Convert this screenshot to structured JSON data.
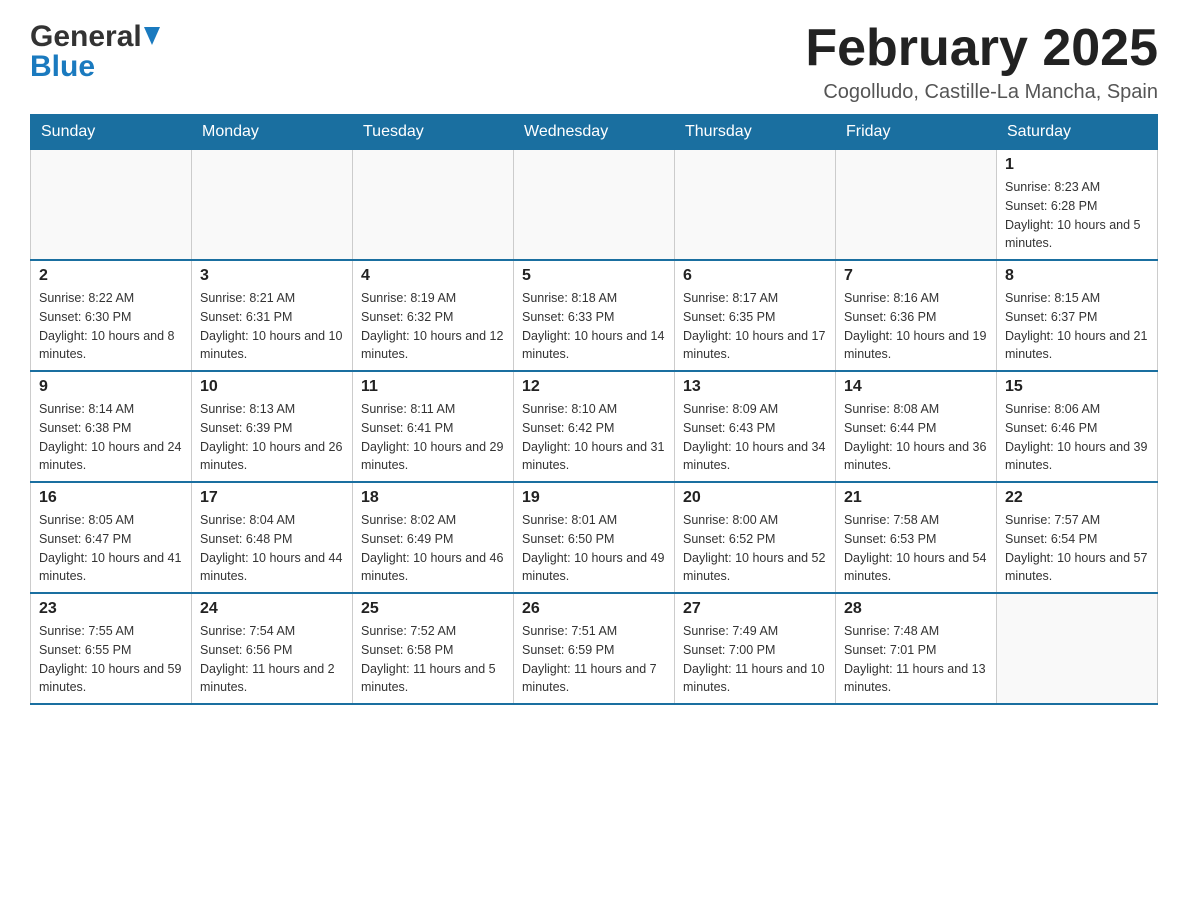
{
  "header": {
    "logo_general": "General",
    "logo_blue": "Blue",
    "month_title": "February 2025",
    "location": "Cogolludo, Castille-La Mancha, Spain"
  },
  "days_of_week": [
    "Sunday",
    "Monday",
    "Tuesday",
    "Wednesday",
    "Thursday",
    "Friday",
    "Saturday"
  ],
  "weeks": [
    [
      {
        "day": "",
        "info": ""
      },
      {
        "day": "",
        "info": ""
      },
      {
        "day": "",
        "info": ""
      },
      {
        "day": "",
        "info": ""
      },
      {
        "day": "",
        "info": ""
      },
      {
        "day": "",
        "info": ""
      },
      {
        "day": "1",
        "info": "Sunrise: 8:23 AM\nSunset: 6:28 PM\nDaylight: 10 hours and 5 minutes."
      }
    ],
    [
      {
        "day": "2",
        "info": "Sunrise: 8:22 AM\nSunset: 6:30 PM\nDaylight: 10 hours and 8 minutes."
      },
      {
        "day": "3",
        "info": "Sunrise: 8:21 AM\nSunset: 6:31 PM\nDaylight: 10 hours and 10 minutes."
      },
      {
        "day": "4",
        "info": "Sunrise: 8:19 AM\nSunset: 6:32 PM\nDaylight: 10 hours and 12 minutes."
      },
      {
        "day": "5",
        "info": "Sunrise: 8:18 AM\nSunset: 6:33 PM\nDaylight: 10 hours and 14 minutes."
      },
      {
        "day": "6",
        "info": "Sunrise: 8:17 AM\nSunset: 6:35 PM\nDaylight: 10 hours and 17 minutes."
      },
      {
        "day": "7",
        "info": "Sunrise: 8:16 AM\nSunset: 6:36 PM\nDaylight: 10 hours and 19 minutes."
      },
      {
        "day": "8",
        "info": "Sunrise: 8:15 AM\nSunset: 6:37 PM\nDaylight: 10 hours and 21 minutes."
      }
    ],
    [
      {
        "day": "9",
        "info": "Sunrise: 8:14 AM\nSunset: 6:38 PM\nDaylight: 10 hours and 24 minutes."
      },
      {
        "day": "10",
        "info": "Sunrise: 8:13 AM\nSunset: 6:39 PM\nDaylight: 10 hours and 26 minutes."
      },
      {
        "day": "11",
        "info": "Sunrise: 8:11 AM\nSunset: 6:41 PM\nDaylight: 10 hours and 29 minutes."
      },
      {
        "day": "12",
        "info": "Sunrise: 8:10 AM\nSunset: 6:42 PM\nDaylight: 10 hours and 31 minutes."
      },
      {
        "day": "13",
        "info": "Sunrise: 8:09 AM\nSunset: 6:43 PM\nDaylight: 10 hours and 34 minutes."
      },
      {
        "day": "14",
        "info": "Sunrise: 8:08 AM\nSunset: 6:44 PM\nDaylight: 10 hours and 36 minutes."
      },
      {
        "day": "15",
        "info": "Sunrise: 8:06 AM\nSunset: 6:46 PM\nDaylight: 10 hours and 39 minutes."
      }
    ],
    [
      {
        "day": "16",
        "info": "Sunrise: 8:05 AM\nSunset: 6:47 PM\nDaylight: 10 hours and 41 minutes."
      },
      {
        "day": "17",
        "info": "Sunrise: 8:04 AM\nSunset: 6:48 PM\nDaylight: 10 hours and 44 minutes."
      },
      {
        "day": "18",
        "info": "Sunrise: 8:02 AM\nSunset: 6:49 PM\nDaylight: 10 hours and 46 minutes."
      },
      {
        "day": "19",
        "info": "Sunrise: 8:01 AM\nSunset: 6:50 PM\nDaylight: 10 hours and 49 minutes."
      },
      {
        "day": "20",
        "info": "Sunrise: 8:00 AM\nSunset: 6:52 PM\nDaylight: 10 hours and 52 minutes."
      },
      {
        "day": "21",
        "info": "Sunrise: 7:58 AM\nSunset: 6:53 PM\nDaylight: 10 hours and 54 minutes."
      },
      {
        "day": "22",
        "info": "Sunrise: 7:57 AM\nSunset: 6:54 PM\nDaylight: 10 hours and 57 minutes."
      }
    ],
    [
      {
        "day": "23",
        "info": "Sunrise: 7:55 AM\nSunset: 6:55 PM\nDaylight: 10 hours and 59 minutes."
      },
      {
        "day": "24",
        "info": "Sunrise: 7:54 AM\nSunset: 6:56 PM\nDaylight: 11 hours and 2 minutes."
      },
      {
        "day": "25",
        "info": "Sunrise: 7:52 AM\nSunset: 6:58 PM\nDaylight: 11 hours and 5 minutes."
      },
      {
        "day": "26",
        "info": "Sunrise: 7:51 AM\nSunset: 6:59 PM\nDaylight: 11 hours and 7 minutes."
      },
      {
        "day": "27",
        "info": "Sunrise: 7:49 AM\nSunset: 7:00 PM\nDaylight: 11 hours and 10 minutes."
      },
      {
        "day": "28",
        "info": "Sunrise: 7:48 AM\nSunset: 7:01 PM\nDaylight: 11 hours and 13 minutes."
      },
      {
        "day": "",
        "info": ""
      }
    ]
  ]
}
